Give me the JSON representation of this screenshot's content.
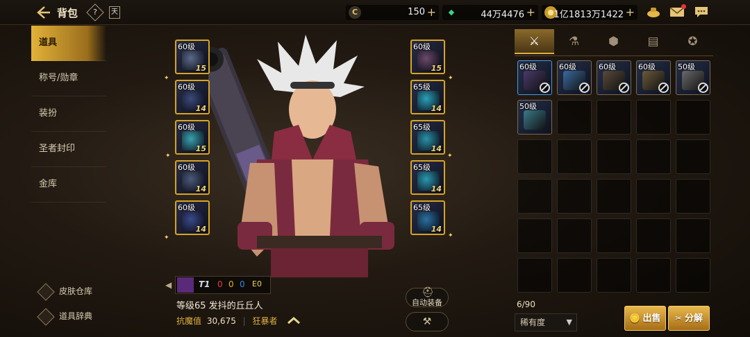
{
  "header": {
    "title": "背包",
    "help_glyph": "?",
    "task_glyph": "天",
    "currencies": [
      {
        "name": "coin",
        "glyph": "C",
        "value": "150"
      },
      {
        "name": "gem",
        "glyph": "◆",
        "value": "44万4476"
      },
      {
        "name": "gold",
        "glyph": "●",
        "value": "1亿1813万1422"
      }
    ],
    "plus_glyph": "+",
    "icons": {
      "pouch": "bag-icon",
      "mail": "mail-icon",
      "chat": "chat-icon"
    }
  },
  "sidebar": {
    "items": [
      {
        "label": "道具",
        "active": true
      },
      {
        "label": "称号/勋章",
        "active": false
      },
      {
        "label": "装扮",
        "active": false
      },
      {
        "label": "圣者封印",
        "active": false
      },
      {
        "label": "金库",
        "active": false
      }
    ],
    "bottom": [
      {
        "label": "皮肤仓库"
      },
      {
        "label": "道具辞典"
      }
    ]
  },
  "equipment": {
    "left": [
      {
        "level": "60级",
        "enhance": "15",
        "color": "#5a6a8a"
      },
      {
        "level": "60级",
        "enhance": "14",
        "color": "#3a4a7a"
      },
      {
        "level": "60级",
        "enhance": "15",
        "color": "#3aa0b0"
      },
      {
        "level": "60级",
        "enhance": "14",
        "color": "#4a5a7a"
      },
      {
        "level": "60级",
        "enhance": "14",
        "color": "#3a4a8a"
      }
    ],
    "right": [
      {
        "level": "60级",
        "enhance": "15",
        "color": "#6a4a6a"
      },
      {
        "level": "65级",
        "enhance": "14",
        "color": "#2aa0b8"
      },
      {
        "level": "65级",
        "enhance": "14",
        "color": "#2a90a8"
      },
      {
        "level": "65级",
        "enhance": "14",
        "color": "#2a98b0"
      },
      {
        "level": "65级",
        "enhance": "14",
        "color": "#2a70a0"
      }
    ]
  },
  "character": {
    "name": "等级65 发抖的丘丘人",
    "stat_label": "抗魔值",
    "stat_value": "30,675",
    "class_name": "狂暴者",
    "emblem_text": "T1",
    "emblem_counts": [
      "0",
      "0",
      "0"
    ],
    "emblem_extra": "E0"
  },
  "actions": {
    "auto_equip": "自动装备"
  },
  "inventory": {
    "tab_icons": [
      "armor-icon",
      "potion-icon",
      "material-icon",
      "card-icon",
      "emblem-icon"
    ],
    "tab_glyphs": [
      "⚔",
      "⚗",
      "⬢",
      "▤",
      "✪"
    ],
    "items": [
      {
        "level": "60级",
        "color": "#4a3a6a",
        "locked": true,
        "selected": true
      },
      {
        "level": "60级",
        "color": "#3a6aa0",
        "locked": true,
        "selected": false
      },
      {
        "level": "60级",
        "color": "#5a4a3a",
        "locked": true,
        "selected": false
      },
      {
        "level": "60级",
        "color": "#6a5a3a",
        "locked": true,
        "selected": false
      },
      {
        "level": "50级",
        "color": "#6a6a6a",
        "locked": true,
        "selected": false
      },
      {
        "level": "50级",
        "color": "#3a7a8a",
        "locked": false,
        "selected": false
      }
    ],
    "total_cells": 30,
    "count": "6/90",
    "sort_label": "稀有度",
    "sort_arrow": "▼"
  },
  "buttons": {
    "sell": "出售",
    "dismantle": "分解"
  }
}
